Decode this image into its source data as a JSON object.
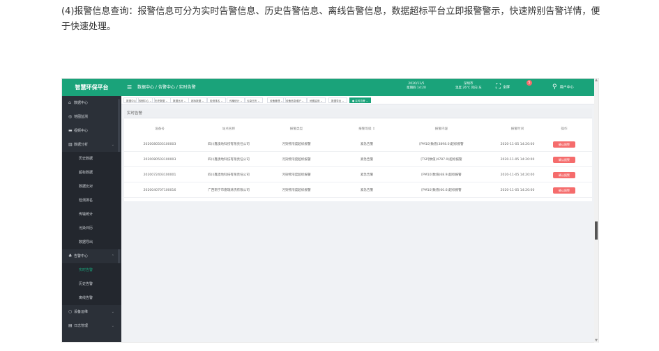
{
  "intro": {
    "text": "(4)报警信息查询：报警信息可分为实时告警信息、历史告警信息、离线告警信息，数据超标平台立即报警警示，快速辨别告警详情，便于快速处理。"
  },
  "header": {
    "brand": "智慧环保平台",
    "menu_icon": "☰",
    "breadcrumb": "数据中心 / 告警中心 / 实时告警",
    "date": "2020/11/5",
    "weekday_time": "星期四 14:20",
    "city": "深圳市",
    "weather": "温度 26℃ 风向 东",
    "fullscreen_label": "全屏",
    "fullscreen_icon": "⛶",
    "alert_count": "5",
    "user_label": "用户中心",
    "user_icon": "⚲"
  },
  "tabs": [
    {
      "label": "数据中心"
    },
    {
      "label": "视频中心 ⌄"
    },
    {
      "label": "历史数据 ⌄"
    },
    {
      "label": "数据比对 ⌄"
    },
    {
      "label": "超标数据 ⌄"
    },
    {
      "label": "检测排名 ⌄"
    },
    {
      "label": "传输统计 ⌄"
    },
    {
      "label": "污染日历 ⌄"
    },
    {
      "label": "设备管理 ⌄"
    },
    {
      "label": "设备信息维护 ⌄"
    },
    {
      "label": "地图监测 ⌄"
    },
    {
      "label": "数据导出 ⌄"
    },
    {
      "label": "● 实时告警 ⌄"
    }
  ],
  "sidebar": {
    "items": [
      {
        "icon": "⌂",
        "label": "数据中心",
        "arrow": ""
      },
      {
        "icon": "◎",
        "label": "地图监测",
        "arrow": ""
      },
      {
        "icon": "▬",
        "label": "视频中心",
        "arrow": ""
      },
      {
        "icon": "▥",
        "label": "数据分析",
        "arrow": "⌄"
      },
      {
        "icon": "",
        "label": "历史数据",
        "arrow": ""
      },
      {
        "icon": "",
        "label": "超标数据",
        "arrow": ""
      },
      {
        "icon": "",
        "label": "数据比对",
        "arrow": ""
      },
      {
        "icon": "",
        "label": "检测排名",
        "arrow": ""
      },
      {
        "icon": "",
        "label": "传输统计",
        "arrow": ""
      },
      {
        "icon": "",
        "label": "污染日历",
        "arrow": ""
      },
      {
        "icon": "",
        "label": "数据导出",
        "arrow": ""
      },
      {
        "icon": "♣",
        "label": "告警中心",
        "arrow": "⌃"
      },
      {
        "icon": "",
        "label": "实时告警",
        "arrow": ""
      },
      {
        "icon": "",
        "label": "历史告警",
        "arrow": ""
      },
      {
        "icon": "",
        "label": "离线告警",
        "arrow": ""
      },
      {
        "icon": "○",
        "label": "设备运维",
        "arrow": "⌄"
      },
      {
        "icon": "▤",
        "label": "日志管理",
        "arrow": "⌄"
      }
    ]
  },
  "table": {
    "title": "实时告警",
    "columns": [
      "设备号",
      "站点名称",
      "报警类型",
      "报警等级 ⇕",
      "报警内容",
      "报警时间",
      "操作"
    ],
    "rows": [
      {
        "device": "2020080503100003",
        "site": "四川鑫澳地科技有限责任公司",
        "type": "污染物浓度超标报警",
        "level": "紧急告警",
        "content": "[PM10]数值(3898.0)超标报警",
        "time": "2020-11-05 14:20:00",
        "action": "确认报警"
      },
      {
        "device": "2020080503100003",
        "site": "四川鑫澳地科技有限责任公司",
        "type": "污染物浓度超标报警",
        "level": "紧急告警",
        "content": "[TSP]数值(4787.0)超标报警",
        "time": "2020-11-05 14:20:00",
        "action": "确认报警"
      },
      {
        "device": "2020072403100001",
        "site": "四川鑫澳地科技有限责任公司",
        "type": "污染物浓度超标报警",
        "level": "紧急告警",
        "content": "[PM10]数值(68.9)超标报警",
        "time": "2020-11-05 14:20:00",
        "action": "确认报警"
      },
      {
        "device": "2020040707100016",
        "site": "广西南宁市嘉瑞清洗有限公司",
        "type": "污染物浓度超标报警",
        "level": "紧急告警",
        "content": "[PM10]数值(60.6)超标报警",
        "time": "2020-11-05 14:20:00",
        "action": "确认报警"
      }
    ]
  },
  "scroll": {
    "up": "▲",
    "down": "▼"
  },
  "colors": {
    "brand": "#1aa37a",
    "sidebar": "#2b3038",
    "danger": "#f56c6c"
  }
}
